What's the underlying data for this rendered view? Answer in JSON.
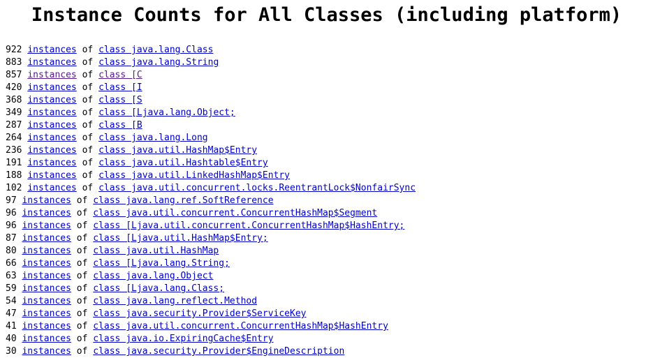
{
  "page": {
    "title": "Instance Counts for All Classes (including platform)",
    "background_color": "#ffffff",
    "text_color": "#000000",
    "link_color": "#0000cc",
    "visited_link_color": "#551a8b",
    "instances_label": "instances",
    "of_label": "of",
    "class_prefix": "class"
  },
  "rows": [
    {
      "count": "922",
      "instances_label": "instances",
      "of_label": "of",
      "class_label": "class java.lang.Class",
      "visited": false
    },
    {
      "count": "883",
      "instances_label": "instances",
      "of_label": "of",
      "class_label": "class java.lang.String",
      "visited": false
    },
    {
      "count": "857",
      "instances_label": "instances",
      "of_label": "of",
      "class_label": "class [C",
      "visited": true
    },
    {
      "count": "420",
      "instances_label": "instances",
      "of_label": "of",
      "class_label": "class [I",
      "visited": false
    },
    {
      "count": "368",
      "instances_label": "instances",
      "of_label": "of",
      "class_label": "class [S",
      "visited": false
    },
    {
      "count": "349",
      "instances_label": "instances",
      "of_label": "of",
      "class_label": "class [Ljava.lang.Object;",
      "visited": false
    },
    {
      "count": "287",
      "instances_label": "instances",
      "of_label": "of",
      "class_label": "class [B",
      "visited": false
    },
    {
      "count": "264",
      "instances_label": "instances",
      "of_label": "of",
      "class_label": "class java.lang.Long",
      "visited": false
    },
    {
      "count": "236",
      "instances_label": "instances",
      "of_label": "of",
      "class_label": "class java.util.HashMap$Entry",
      "visited": false
    },
    {
      "count": "191",
      "instances_label": "instances",
      "of_label": "of",
      "class_label": "class java.util.Hashtable$Entry",
      "visited": false
    },
    {
      "count": "188",
      "instances_label": "instances",
      "of_label": "of",
      "class_label": "class java.util.LinkedHashMap$Entry",
      "visited": false
    },
    {
      "count": "102",
      "instances_label": "instances",
      "of_label": "of",
      "class_label": "class java.util.concurrent.locks.ReentrantLock$NonfairSync",
      "visited": false
    },
    {
      "count": "97",
      "instances_label": "instances",
      "of_label": "of",
      "class_label": "class java.lang.ref.SoftReference",
      "visited": false
    },
    {
      "count": "96",
      "instances_label": "instances",
      "of_label": "of",
      "class_label": "class java.util.concurrent.ConcurrentHashMap$Segment",
      "visited": false
    },
    {
      "count": "96",
      "instances_label": "instances",
      "of_label": "of",
      "class_label": "class [Ljava.util.concurrent.ConcurrentHashMap$HashEntry;",
      "visited": false
    },
    {
      "count": "87",
      "instances_label": "instances",
      "of_label": "of",
      "class_label": "class [Ljava.util.HashMap$Entry;",
      "visited": false
    },
    {
      "count": "80",
      "instances_label": "instances",
      "of_label": "of",
      "class_label": "class java.util.HashMap",
      "visited": false
    },
    {
      "count": "66",
      "instances_label": "instances",
      "of_label": "of",
      "class_label": "class [Ljava.lang.String;",
      "visited": false
    },
    {
      "count": "63",
      "instances_label": "instances",
      "of_label": "of",
      "class_label": "class java.lang.Object",
      "visited": false
    },
    {
      "count": "59",
      "instances_label": "instances",
      "of_label": "of",
      "class_label": "class [Ljava.lang.Class;",
      "visited": false
    },
    {
      "count": "54",
      "instances_label": "instances",
      "of_label": "of",
      "class_label": "class java.lang.reflect.Method",
      "visited": false
    },
    {
      "count": "47",
      "instances_label": "instances",
      "of_label": "of",
      "class_label": "class java.security.Provider$ServiceKey",
      "visited": false
    },
    {
      "count": "41",
      "instances_label": "instances",
      "of_label": "of",
      "class_label": "class java.util.concurrent.ConcurrentHashMap$HashEntry",
      "visited": false
    },
    {
      "count": "40",
      "instances_label": "instances",
      "of_label": "of",
      "class_label": "class java.io.ExpiringCache$Entry",
      "visited": false
    },
    {
      "count": "30",
      "instances_label": "instances",
      "of_label": "of",
      "class_label": "class java.security.Provider$EngineDescription",
      "visited": false
    }
  ]
}
